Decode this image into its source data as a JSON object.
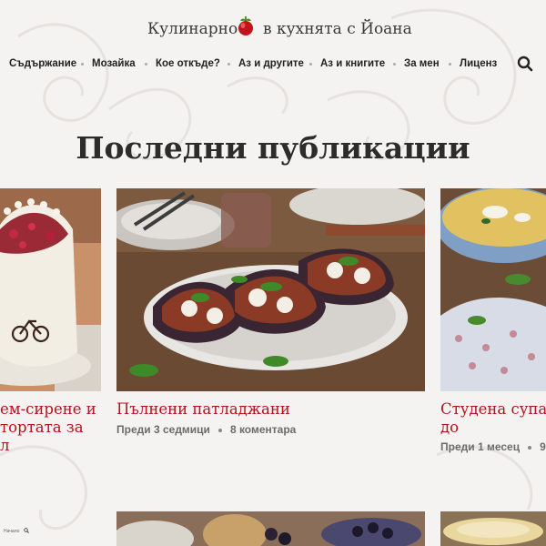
{
  "site": {
    "title_left": "Кулинарно",
    "title_right": "в кухнята с Йоана"
  },
  "nav": {
    "items": [
      "Съдържание",
      "Мозайка",
      "Кое откъде?",
      "Аз и другите",
      "Аз и книгите",
      "За мен",
      "Лиценз"
    ]
  },
  "page_title": "Последни публикации",
  "posts": [
    {
      "title_lines": [
        "ем-сирене и",
        "тортата за",
        "л"
      ]
    },
    {
      "title": "Пълнени патладжани",
      "meta_time": "Преди 3 седмици",
      "meta_comments": "8 коментара"
    },
    {
      "title_lines": [
        "Студена супа о",
        "до"
      ],
      "meta_time": "Преди 1 месец",
      "meta_comments": "9 к"
    }
  ],
  "footer_mini": {
    "label": "Начало"
  },
  "colors": {
    "accent": "#b3141c",
    "background": "#f4f3f1",
    "text": "#222222"
  }
}
